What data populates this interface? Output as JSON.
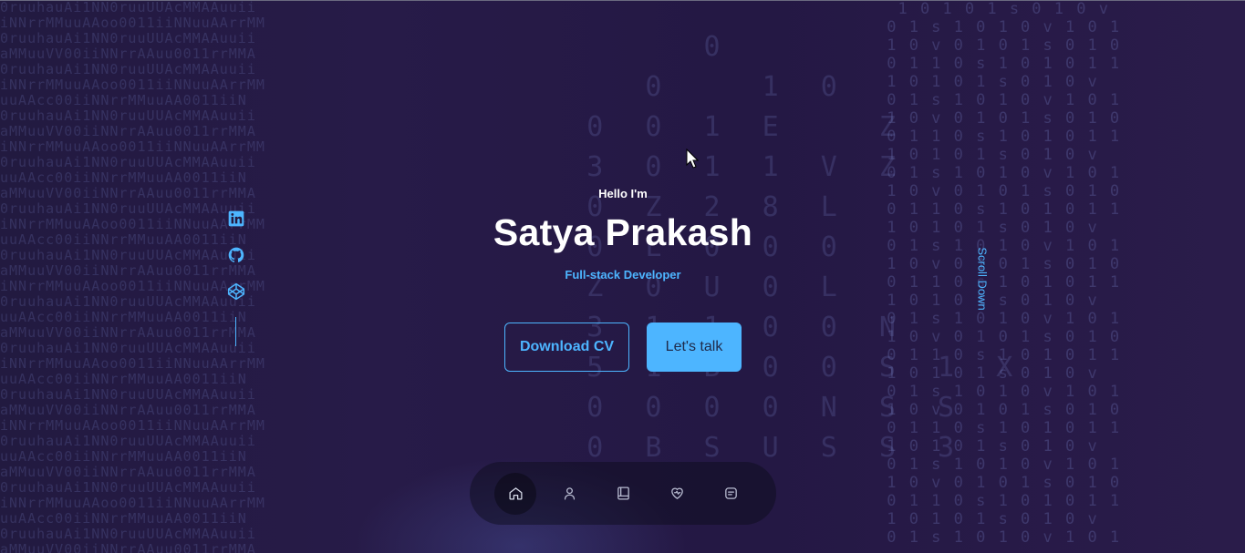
{
  "hero": {
    "greeting": "Hello I'm",
    "name": "Satya Prakash",
    "role": "Full-stack Developer"
  },
  "buttons": {
    "download_cv": "Download CV",
    "lets_talk": "Let's talk"
  },
  "social": {
    "items": [
      {
        "name": "linkedin-icon"
      },
      {
        "name": "github-icon"
      },
      {
        "name": "codepen-icon"
      }
    ]
  },
  "scroll": {
    "label": "Scroll Down"
  },
  "nav": {
    "items": [
      {
        "icon": "home-icon",
        "active": true
      },
      {
        "icon": "user-icon",
        "active": false
      },
      {
        "icon": "book-icon",
        "active": false
      },
      {
        "icon": "services-icon",
        "active": false
      },
      {
        "icon": "message-icon",
        "active": false
      }
    ]
  },
  "colors": {
    "background": "#24193f",
    "accent": "#4db5ff",
    "text": "#ffffff"
  }
}
